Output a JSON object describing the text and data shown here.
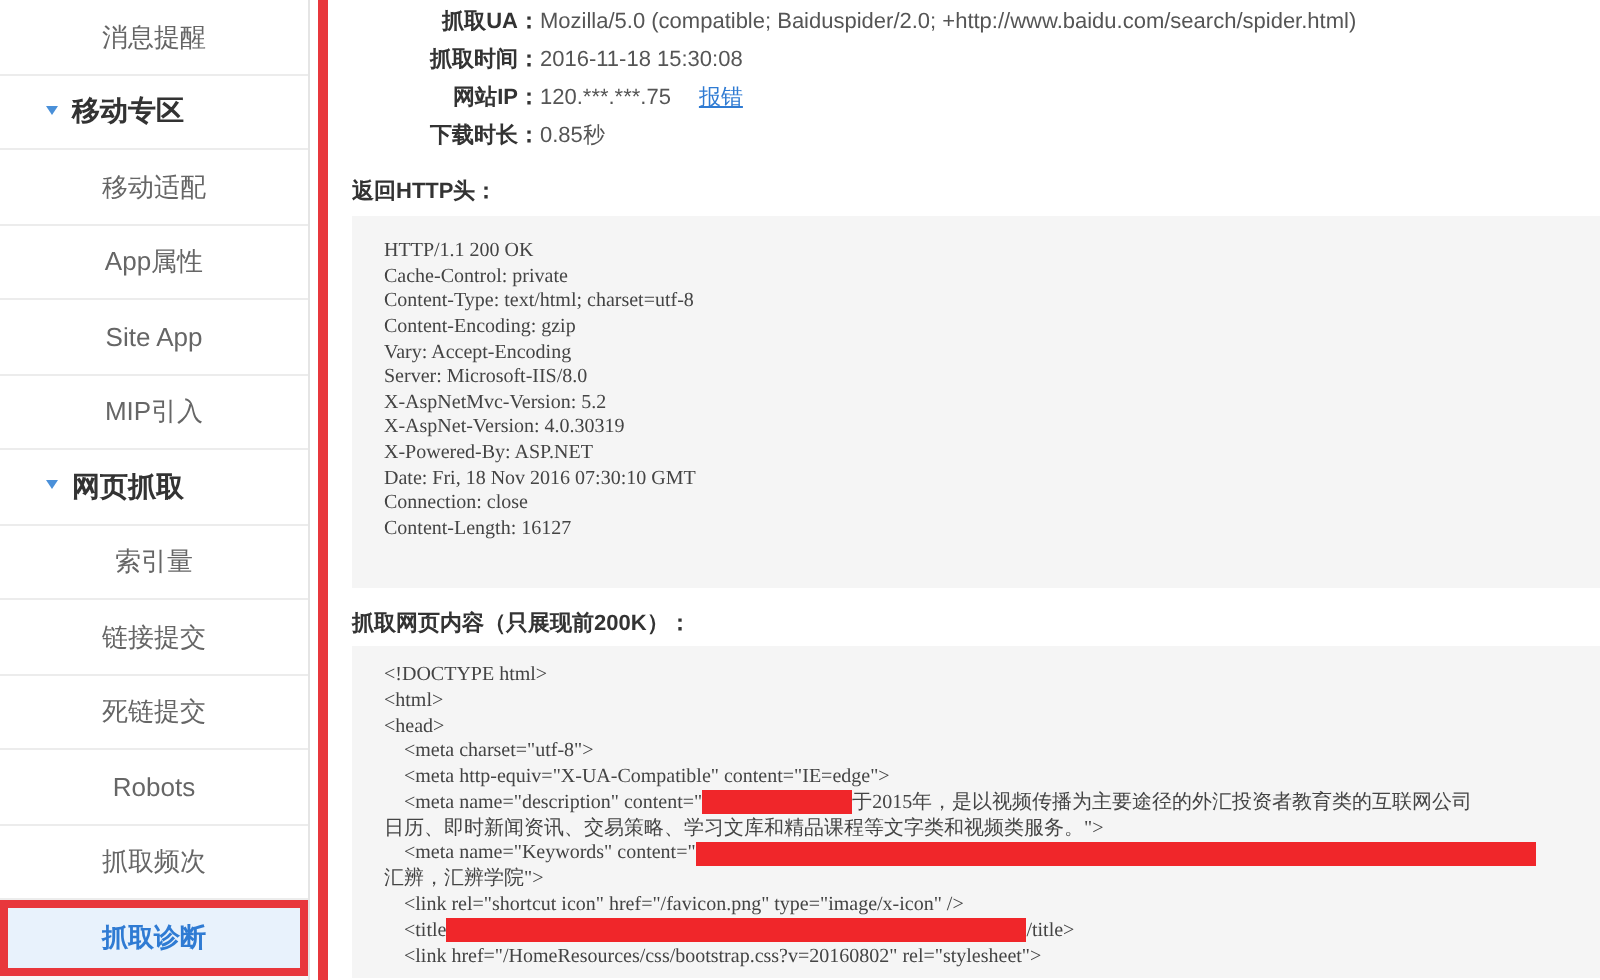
{
  "sidebar": {
    "sections": [
      {
        "items": [
          {
            "label": "消息提醒",
            "selected": false,
            "highlighted": false
          }
        ]
      },
      {
        "title": "移动专区",
        "expanded": true,
        "items": [
          {
            "label": "移动适配",
            "selected": false,
            "highlighted": false
          },
          {
            "label": "App属性",
            "selected": false,
            "highlighted": false
          },
          {
            "label": "Site App",
            "selected": false,
            "highlighted": false
          },
          {
            "label": "MIP引入",
            "selected": false,
            "highlighted": false
          }
        ]
      },
      {
        "title": "网页抓取",
        "expanded": true,
        "items": [
          {
            "label": "索引量",
            "selected": false,
            "highlighted": false
          },
          {
            "label": "链接提交",
            "selected": false,
            "highlighted": false
          },
          {
            "label": "死链提交",
            "selected": false,
            "highlighted": false
          },
          {
            "label": "Robots",
            "selected": false,
            "highlighted": false
          },
          {
            "label": "抓取频次",
            "selected": false,
            "highlighted": false
          },
          {
            "label": "抓取诊断",
            "selected": true,
            "highlighted": true
          }
        ]
      }
    ]
  },
  "info": [
    {
      "label": "抓取UA：",
      "value": "Mozilla/5.0 (compatible; Baiduspider/2.0; +http://www.baidu.com/search/spider.html)"
    },
    {
      "label": "抓取时间：",
      "value": "2016-11-18 15:30:08"
    },
    {
      "label": "网站IP：",
      "value": "120.***.***.75",
      "link": "报错"
    },
    {
      "label": "下载时长：",
      "value": "0.85秒"
    }
  ],
  "headers_section": {
    "title": "返回HTTP头：",
    "lines": [
      "HTTP/1.1 200 OK",
      "Cache-Control: private",
      "Content-Type: text/html; charset=utf-8",
      "Content-Encoding: gzip",
      "Vary: Accept-Encoding",
      "Server: Microsoft-IIS/8.0",
      "X-AspNetMvc-Version: 5.2",
      "X-AspNet-Version: 4.0.30319",
      "X-Powered-By: ASP.NET",
      "Date: Fri, 18 Nov 2016 07:30:10 GMT",
      "Connection: close",
      "Content-Length: 16127"
    ]
  },
  "content_section": {
    "title": "抓取网页内容（只展现前200K）：",
    "lines": [
      {
        "segments": [
          {
            "kind": "text",
            "text": "<!DOCTYPE html>"
          }
        ]
      },
      {
        "segments": [
          {
            "kind": "text",
            "text": "<html>"
          }
        ]
      },
      {
        "segments": [
          {
            "kind": "text",
            "text": "<head>"
          }
        ]
      },
      {
        "segments": [
          {
            "kind": "text",
            "text": "    <meta charset=\"utf-8\">"
          }
        ]
      },
      {
        "segments": [
          {
            "kind": "text",
            "text": "    <meta http-equiv=\"X-UA-Compatible\" content=\"IE=edge\">"
          }
        ]
      },
      {
        "segments": [
          {
            "kind": "text",
            "text": "    <meta name=\"description\" content=\""
          },
          {
            "kind": "redacted"
          },
          {
            "kind": "text",
            "text": "于2015年，是以视频传播为主要途径的外汇投资者教育类的互联网公司"
          }
        ]
      },
      {
        "segments": [
          {
            "kind": "text",
            "text": "日历、即时新闻资讯、交易策略、学习文库和精品课程等文字类和视频类服务。\">"
          }
        ]
      },
      {
        "segments": [
          {
            "kind": "text",
            "text": "    <meta name=\"Keywords\" content=\""
          },
          {
            "kind": "redacted-wide"
          }
        ]
      },
      {
        "segments": [
          {
            "kind": "text",
            "text": "汇辨，汇辨学院\">"
          }
        ]
      },
      {
        "segments": [
          {
            "kind": "text",
            "text": "    <link rel=\"shortcut icon\" href=\"/favicon.png\" type=\"image/x-icon\" />"
          }
        ]
      },
      {
        "segments": [
          {
            "kind": "text",
            "text": "    <title"
          },
          {
            "kind": "redacted-long"
          },
          {
            "kind": "text",
            "text": "/title>"
          }
        ]
      },
      {
        "segments": [
          {
            "kind": "text",
            "text": "    <link href=\"/HomeResources/css/bootstrap.css?v=20160802\" rel=\"stylesheet\">"
          }
        ]
      }
    ]
  }
}
